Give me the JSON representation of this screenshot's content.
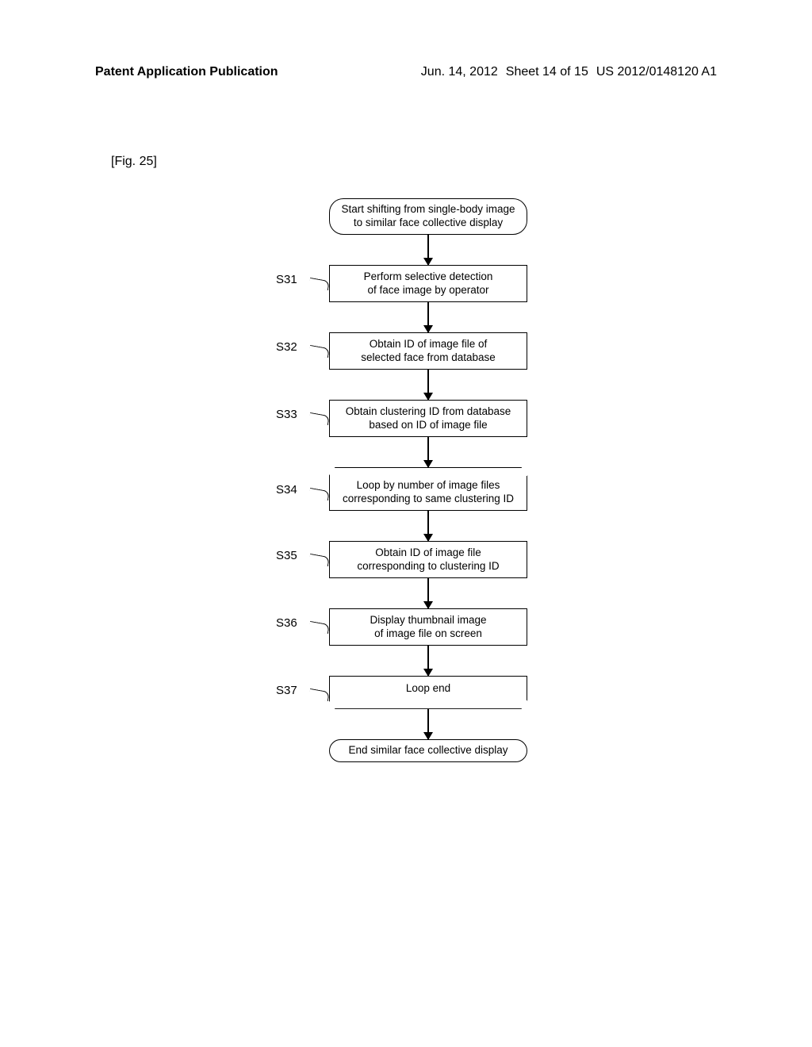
{
  "header": {
    "left": "Patent Application Publication",
    "date": "Jun. 14, 2012",
    "sheet": "Sheet 14 of 15",
    "pubno": "US 2012/0148120 A1"
  },
  "figure_label": "[Fig. 25]",
  "flowchart": {
    "start": "Start shifting from single-body image\nto similar face collective display",
    "steps": [
      {
        "label": "S31",
        "text": "Perform selective detection\nof face image by operator",
        "type": "process"
      },
      {
        "label": "S32",
        "text": "Obtain ID of image file of\nselected face from database",
        "type": "process"
      },
      {
        "label": "S33",
        "text": "Obtain clustering ID from database\nbased on ID of image file",
        "type": "process"
      },
      {
        "label": "S34",
        "text": "Loop by number of image files\ncorresponding to same clustering ID",
        "type": "loop-start"
      },
      {
        "label": "S35",
        "text": "Obtain ID of image file\ncorresponding to clustering ID",
        "type": "process"
      },
      {
        "label": "S36",
        "text": "Display thumbnail image\nof image file on screen",
        "type": "process"
      },
      {
        "label": "S37",
        "text": "Loop end",
        "type": "loop-end"
      }
    ],
    "end": "End similar face collective display"
  },
  "chart_data": {
    "type": "flowchart",
    "title": "Fig. 25 - Similar face collective display process",
    "nodes": [
      {
        "id": "start",
        "type": "terminator",
        "text": "Start shifting from single-body image to similar face collective display"
      },
      {
        "id": "S31",
        "type": "process",
        "text": "Perform selective detection of face image by operator"
      },
      {
        "id": "S32",
        "type": "process",
        "text": "Obtain ID of image file of selected face from database"
      },
      {
        "id": "S33",
        "type": "process",
        "text": "Obtain clustering ID from database based on ID of image file"
      },
      {
        "id": "S34",
        "type": "loop-start",
        "text": "Loop by number of image files corresponding to same clustering ID"
      },
      {
        "id": "S35",
        "type": "process",
        "text": "Obtain ID of image file corresponding to clustering ID"
      },
      {
        "id": "S36",
        "type": "process",
        "text": "Display thumbnail image of image file on screen"
      },
      {
        "id": "S37",
        "type": "loop-end",
        "text": "Loop end"
      },
      {
        "id": "end",
        "type": "terminator",
        "text": "End similar face collective display"
      }
    ],
    "edges": [
      {
        "from": "start",
        "to": "S31"
      },
      {
        "from": "S31",
        "to": "S32"
      },
      {
        "from": "S32",
        "to": "S33"
      },
      {
        "from": "S33",
        "to": "S34"
      },
      {
        "from": "S34",
        "to": "S35"
      },
      {
        "from": "S35",
        "to": "S36"
      },
      {
        "from": "S36",
        "to": "S37"
      },
      {
        "from": "S37",
        "to": "end"
      }
    ]
  }
}
